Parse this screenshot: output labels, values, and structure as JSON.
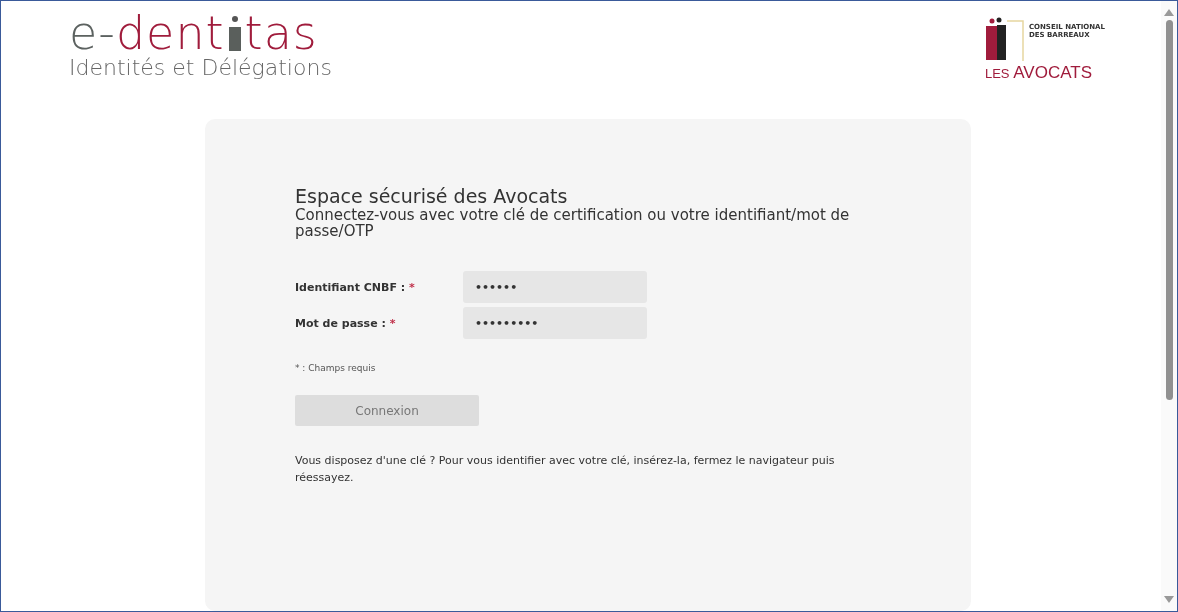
{
  "header": {
    "logo": {
      "prefix": "e-",
      "middle": "dent",
      "suffix": "tas",
      "tagline": "Identités et Délégations"
    },
    "partner_logo": {
      "small_text": "CONSEIL NATIONAL\nDES BARREAUX",
      "large_prefix": "LES",
      "large_text": "AVOCATS"
    }
  },
  "login": {
    "title": "Espace sécurisé des Avocats",
    "subtitle": "Connectez-vous avec votre clé de certification ou votre identifiant/mot de passe/OTP",
    "fields": [
      {
        "label": "Identifiant CNBF :",
        "required_mark": "*",
        "value": "••••••"
      },
      {
        "label": "Mot de passe :",
        "required_mark": "*",
        "value": "•••••••••"
      }
    ],
    "required_note": "* : Champs requis",
    "submit": {
      "label": "Connexion",
      "disabled": true
    },
    "note": "Vous disposez d'une clé ? Pour vous identifier avec votre clé, insérez-la, fermez le navigateur puis réessayez."
  }
}
